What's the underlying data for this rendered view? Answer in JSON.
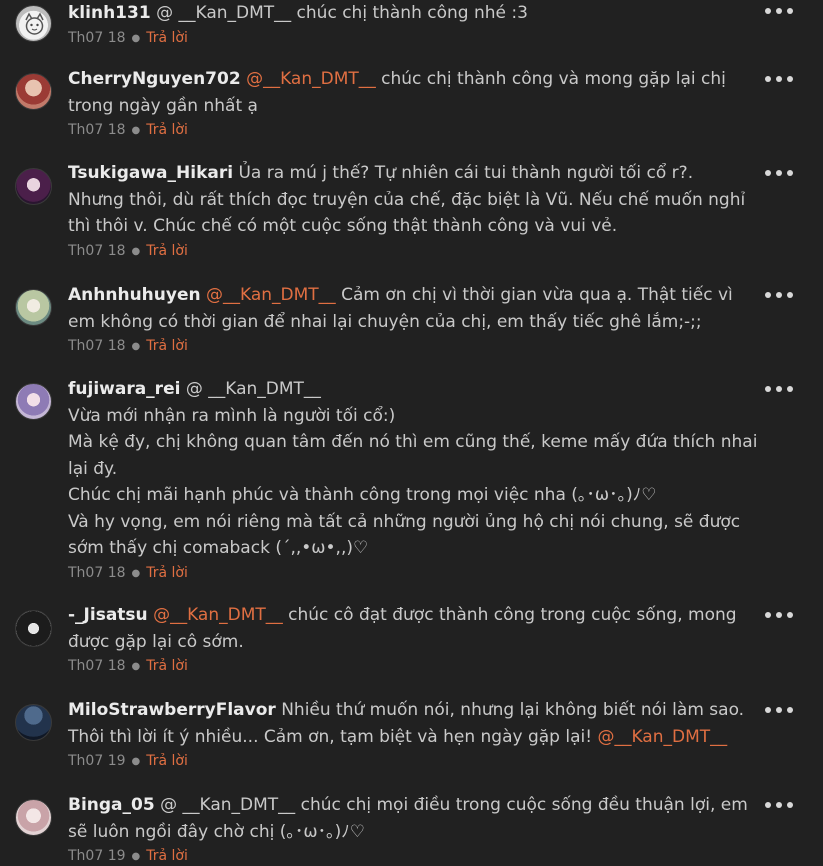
{
  "comments": [
    {
      "username": "klinh131",
      "mention": "@ __Kan_DMT__",
      "mention_highlight": false,
      "text": " chúc chị thành công nhé :3",
      "date": "Th07 18",
      "reply": "Trả lời",
      "avatar_icon": "cat-face-avatar"
    },
    {
      "username": "CherryNguyen702",
      "mention": "@__Kan_DMT__",
      "mention_highlight": true,
      "text": " chúc chị thành công và mong gặp lại chị trong ngày gần nhất ạ",
      "date": "Th07 18",
      "reply": "Trả lời",
      "avatar_icon": "anime-girl-avatar"
    },
    {
      "username": "Tsukigawa_Hikari",
      "mention": "",
      "mention_highlight": false,
      "text": "Ủa ra mú j thế? Tự nhiên cái tui thành người tối cổ r?.\nNhưng thôi, dù rất thích đọc truyện của chế, đặc biệt là Vũ. Nếu chế muốn nghỉ thì thôi v. Chúc chế có một cuộc sống thật thành công và vui vẻ.",
      "date": "Th07 18",
      "reply": "Trả lời",
      "avatar_icon": "anime-girl-avatar"
    },
    {
      "username": "Anhnhuhuyen",
      "mention": "@__Kan_DMT__",
      "mention_highlight": true,
      "text": "  Cảm ơn chị vì thời gian vừa qua ạ. Thật tiếc vì em không có thời gian để nhai lại chuyện của chị, em thấy tiếc ghê lắm;-;;",
      "date": "Th07 18",
      "reply": "Trả lời",
      "avatar_icon": "anime-girl-avatar"
    },
    {
      "username": "fujiwara_rei",
      "mention": "@ __Kan_DMT__",
      "mention_highlight": false,
      "text": "\nVừa mới nhận ra mình là người tối cổ:)\nMà kệ đy, chị không quan tâm đến nó thì em cũng thế, keme mấy đứa thích nhai lại đy.\nChúc chị mãi hạnh phúc và thành công trong mọi việc nha (｡･ω･｡)ﾉ♡\nVà hy vọng, em nói riêng mà tất cả những người ủng hộ chị nói chung, sẽ được sớm thấy chị comaback (´,,•ω•,,)♡",
      "date": "Th07 18",
      "reply": "Trả lời",
      "avatar_icon": "anime-girl-avatar"
    },
    {
      "username": "-_Jisatsu",
      "mention": "@__Kan_DMT__",
      "mention_highlight": true,
      "text": " chúc cô đạt được thành công trong cuộc sống, mong được gặp lại cô sớm.",
      "date": "Th07 18",
      "reply": "Trả lời",
      "avatar_icon": "dark-hair-avatar"
    },
    {
      "username": "MiloStrawberryFlavor",
      "mention": "",
      "mention_highlight": false,
      "text": "Nhiều thứ muốn nói, nhưng lại không biết nói làm sao. Thôi thì lời ít ý nhiều... Cảm ơn, tạm biệt và hẹn ngày gặp lại! ",
      "trailing_mention": "@__Kan_DMT__",
      "date": "Th07 19",
      "reply": "Trả lời",
      "avatar_icon": "night-scene-avatar"
    },
    {
      "username": "Binga_05",
      "mention": "@ __Kan_DMT__",
      "mention_highlight": false,
      "text": "  chúc chị mọi điều trong cuộc sống đều thuận lợi, em sẽ luôn ngồi đây chờ chị (｡･ω･｡)ﾉ♡",
      "date": "Th07 19",
      "reply": "Trả lời",
      "avatar_icon": "anime-girl-avatar"
    }
  ]
}
